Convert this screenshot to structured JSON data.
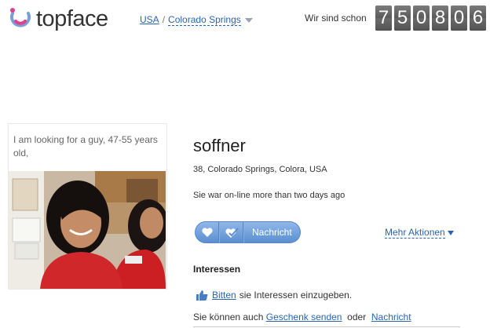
{
  "header": {
    "logo_text": "topface",
    "breadcrumb": {
      "country": "USA",
      "separator": "/",
      "city": "Colorado Springs"
    },
    "counter_label": "Wir sind schon",
    "counter_digits": [
      "7",
      "5",
      "0",
      "8",
      "0",
      "6"
    ]
  },
  "left": {
    "looking_for": "I am looking for a guy, 47-55 years old,"
  },
  "profile": {
    "name": "soffner",
    "info": "38,  Colorado Springs, Colora, USA",
    "online_status": "Sie war on-line more than two days ago",
    "message_button": "Nachricht",
    "more_actions": "Mehr Aktionen"
  },
  "interests": {
    "heading": "Interessen",
    "ask_link": "Bitten",
    "ask_text": "sie Interessen einzugeben.",
    "also_prefix": "Sie können auch",
    "gift_link": "Geschenk senden",
    "or_text": "oder",
    "message_link": "Nachricht"
  },
  "colors": {
    "link": "#2a64b0",
    "button": "#6b9bd8"
  }
}
